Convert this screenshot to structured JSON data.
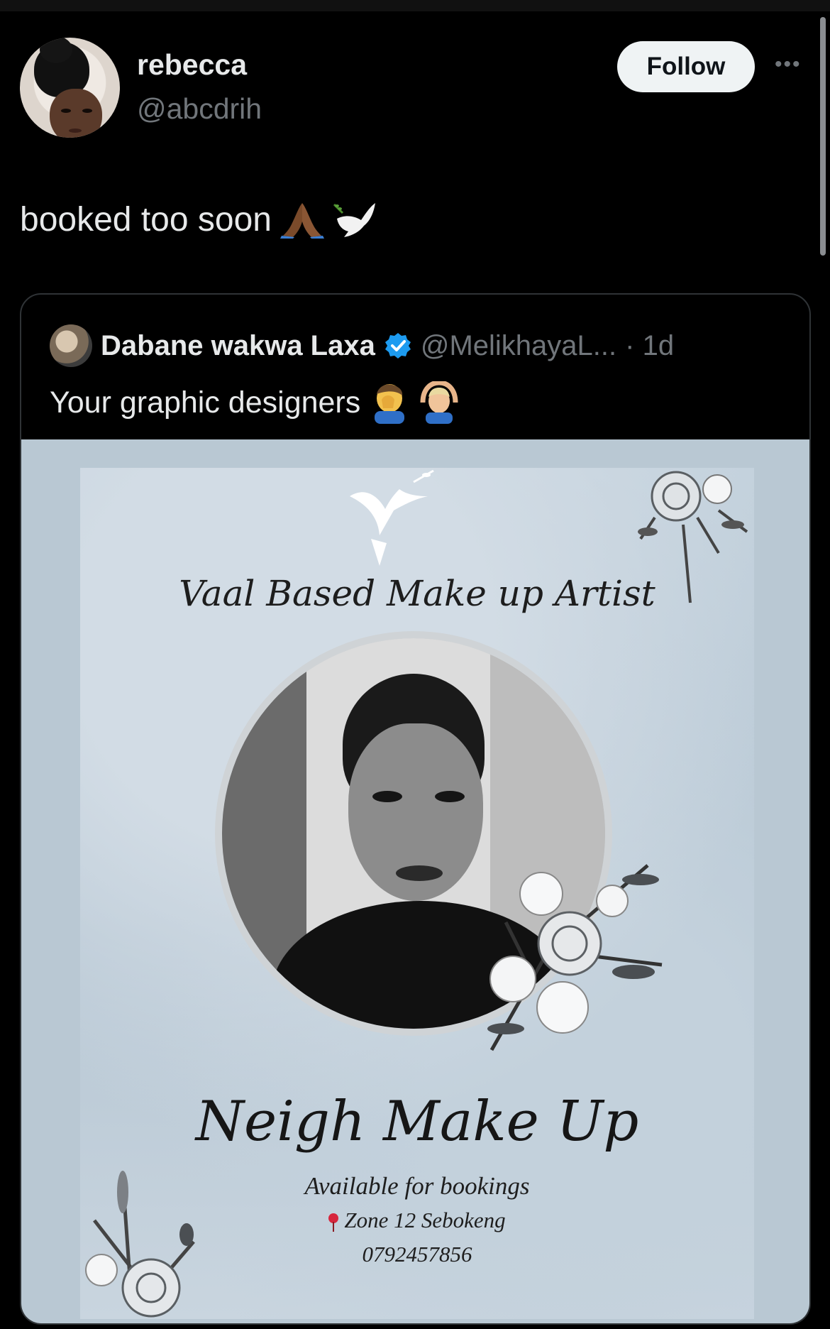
{
  "post": {
    "author_name": "rebecca",
    "author_handle": "@abcdrih",
    "follow_label": "Follow",
    "more_label": "•••",
    "text": "booked too soon",
    "text_emojis": [
      "folded-hands",
      "dove"
    ]
  },
  "quoted": {
    "author_name": "Dabane wakwa Laxa",
    "author_handle": "@MelikhayaL...",
    "time": "· 1d",
    "verified": true,
    "text": "Your graphic designers",
    "text_emojis": [
      "man-facepalming",
      "person-gesturing-ok"
    ]
  },
  "poster": {
    "subtitle": "Vaal Based Make up Artist",
    "title": "Neigh Make Up",
    "availability": "Available for bookings",
    "location": "Zone 12 Sebokeng",
    "phone": "0792457856"
  },
  "colors": {
    "background": "#000000",
    "text_primary": "#e7e9ea",
    "text_secondary": "#71767b",
    "verified_blue": "#1d9bf0",
    "poster_bg": "#b9c8d3"
  }
}
